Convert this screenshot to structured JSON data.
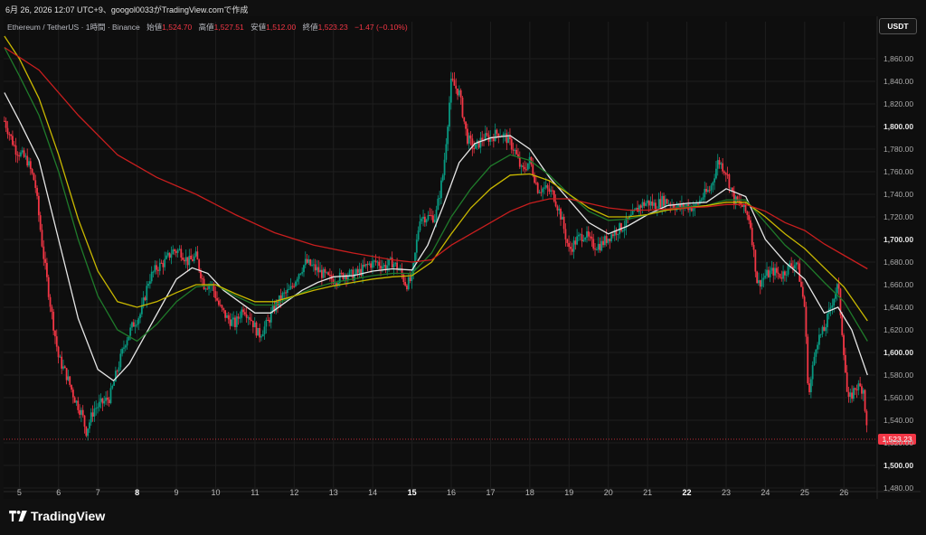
{
  "header": {
    "caption": "6月 26, 2026 12:07 UTC+9、googol0033がTradingView.comで作成"
  },
  "legend": {
    "symbol": "Ethereum / TetherUS · 1時間 · Binance",
    "open_label": "始値",
    "open_value": "1,524.70",
    "high_label": "高値",
    "high_value": "1,527.51",
    "low_label": "安値",
    "low_value": "1,512.00",
    "close_label": "終値",
    "close_value": "1,523.23",
    "change": "−1.47 (−0.10%)"
  },
  "currency_button": "USDT",
  "brand": "TradingView",
  "colors": {
    "up": "#089981",
    "down": "#f23645",
    "ma_fast": "#e6e6e6",
    "ma_mid": "#1f7a2a",
    "ma_slow": "#c9b800",
    "ma_long": "#c81e1e",
    "grid": "#1e1e1e",
    "price_tag": "#f23645"
  },
  "chart_data": {
    "type": "candlestick",
    "title": "Ethereum / TetherUS · 1時間 · Binance",
    "xlabel": "",
    "ylabel": "",
    "ylim": [
      1480,
      1880
    ],
    "y_ticks": [
      1480,
      1500,
      1520,
      1540,
      1560,
      1580,
      1600,
      1620,
      1640,
      1660,
      1680,
      1700,
      1720,
      1740,
      1760,
      1780,
      1800,
      1820,
      1840,
      1860
    ],
    "y_tick_labels": [
      "1,480.00",
      "1,500.00",
      "1,520.00",
      "1,540.00",
      "1,560.00",
      "1,580.00",
      "1,600.00",
      "1,620.00",
      "1,640.00",
      "1,660.00",
      "1,680.00",
      "1,700.00",
      "1,720.00",
      "1,740.00",
      "1,760.00",
      "1,780.00",
      "1,800.00",
      "1,820.00",
      "1,840.00",
      "1,860.00"
    ],
    "bold_y_ticks": [
      "1,500.00",
      "1,600.00",
      "1,700.00",
      "1,800.00"
    ],
    "xlim": [
      4.6,
      26.8
    ],
    "x_ticks": [
      5,
      6,
      7,
      8,
      9,
      10,
      11,
      12,
      13,
      14,
      15,
      16,
      17,
      18,
      19,
      20,
      21,
      22,
      23,
      24,
      25,
      26
    ],
    "x_tick_labels": [
      "5",
      "6",
      "7",
      "8",
      "9",
      "10",
      "11",
      "12",
      "13",
      "14",
      "15",
      "16",
      "17",
      "18",
      "19",
      "20",
      "21",
      "22",
      "23",
      "24",
      "25",
      "26"
    ],
    "bold_x_ticks": [
      "8",
      "15",
      "22"
    ],
    "last_price": 1523.23,
    "last_price_label": "1,523.23",
    "price_path": [
      [
        4.62,
        1805
      ],
      [
        4.9,
        1780
      ],
      [
        5.2,
        1770
      ],
      [
        5.4,
        1750
      ],
      [
        5.6,
        1690
      ],
      [
        5.8,
        1640
      ],
      [
        6.0,
        1595
      ],
      [
        6.2,
        1580
      ],
      [
        6.4,
        1560
      ],
      [
        6.6,
        1545
      ],
      [
        6.7,
        1530
      ],
      [
        6.9,
        1550
      ],
      [
        7.1,
        1555
      ],
      [
        7.3,
        1560
      ],
      [
        7.5,
        1585
      ],
      [
        7.7,
        1610
      ],
      [
        7.9,
        1625
      ],
      [
        8.1,
        1635
      ],
      [
        8.3,
        1665
      ],
      [
        8.5,
        1675
      ],
      [
        8.7,
        1680
      ],
      [
        8.9,
        1690
      ],
      [
        9.1,
        1690
      ],
      [
        9.3,
        1680
      ],
      [
        9.5,
        1685
      ],
      [
        9.7,
        1660
      ],
      [
        9.9,
        1660
      ],
      [
        10.1,
        1640
      ],
      [
        10.3,
        1630
      ],
      [
        10.5,
        1625
      ],
      [
        10.7,
        1640
      ],
      [
        10.9,
        1630
      ],
      [
        11.1,
        1615
      ],
      [
        11.3,
        1625
      ],
      [
        11.5,
        1640
      ],
      [
        11.7,
        1650
      ],
      [
        11.9,
        1655
      ],
      [
        12.1,
        1670
      ],
      [
        12.3,
        1680
      ],
      [
        12.5,
        1675
      ],
      [
        12.7,
        1670
      ],
      [
        12.9,
        1665
      ],
      [
        13.1,
        1665
      ],
      [
        13.3,
        1670
      ],
      [
        13.5,
        1668
      ],
      [
        13.7,
        1672
      ],
      [
        13.9,
        1678
      ],
      [
        14.1,
        1680
      ],
      [
        14.3,
        1676
      ],
      [
        14.5,
        1680
      ],
      [
        14.7,
        1672
      ],
      [
        14.85,
        1660
      ],
      [
        15.0,
        1665
      ],
      [
        15.2,
        1720
      ],
      [
        15.4,
        1720
      ],
      [
        15.6,
        1720
      ],
      [
        15.8,
        1760
      ],
      [
        16.0,
        1840
      ],
      [
        16.2,
        1830
      ],
      [
        16.4,
        1790
      ],
      [
        16.6,
        1780
      ],
      [
        16.8,
        1790
      ],
      [
        17.0,
        1790
      ],
      [
        17.2,
        1795
      ],
      [
        17.4,
        1790
      ],
      [
        17.6,
        1780
      ],
      [
        17.8,
        1760
      ],
      [
        18.0,
        1770
      ],
      [
        18.2,
        1745
      ],
      [
        18.4,
        1745
      ],
      [
        18.6,
        1740
      ],
      [
        18.8,
        1720
      ],
      [
        19.0,
        1690
      ],
      [
        19.2,
        1700
      ],
      [
        19.4,
        1705
      ],
      [
        19.6,
        1695
      ],
      [
        19.8,
        1695
      ],
      [
        20.0,
        1702
      ],
      [
        20.2,
        1708
      ],
      [
        20.4,
        1712
      ],
      [
        20.6,
        1720
      ],
      [
        20.8,
        1730
      ],
      [
        21.0,
        1733
      ],
      [
        21.2,
        1730
      ],
      [
        21.4,
        1735
      ],
      [
        21.6,
        1732
      ],
      [
        21.8,
        1728
      ],
      [
        22.0,
        1730
      ],
      [
        22.2,
        1728
      ],
      [
        22.4,
        1738
      ],
      [
        22.6,
        1745
      ],
      [
        22.8,
        1770
      ],
      [
        23.0,
        1760
      ],
      [
        23.2,
        1735
      ],
      [
        23.4,
        1730
      ],
      [
        23.6,
        1718
      ],
      [
        23.8,
        1660
      ],
      [
        24.0,
        1668
      ],
      [
        24.2,
        1672
      ],
      [
        24.4,
        1668
      ],
      [
        24.6,
        1676
      ],
      [
        24.8,
        1680
      ],
      [
        25.0,
        1640
      ],
      [
        25.1,
        1560
      ],
      [
        25.3,
        1610
      ],
      [
        25.5,
        1620
      ],
      [
        25.7,
        1645
      ],
      [
        25.85,
        1660
      ],
      [
        26.0,
        1600
      ],
      [
        26.1,
        1555
      ],
      [
        26.3,
        1570
      ],
      [
        26.5,
        1568
      ],
      [
        26.6,
        1523
      ]
    ],
    "series": [
      {
        "key": "ma_fast",
        "points": [
          [
            4.62,
            1830
          ],
          [
            5.0,
            1805
          ],
          [
            5.5,
            1770
          ],
          [
            6.0,
            1700
          ],
          [
            6.5,
            1630
          ],
          [
            7.0,
            1585
          ],
          [
            7.4,
            1575
          ],
          [
            7.8,
            1590
          ],
          [
            8.2,
            1615
          ],
          [
            8.6,
            1640
          ],
          [
            9.0,
            1665
          ],
          [
            9.4,
            1675
          ],
          [
            9.8,
            1670
          ],
          [
            10.2,
            1655
          ],
          [
            10.6,
            1645
          ],
          [
            11.0,
            1635
          ],
          [
            11.4,
            1635
          ],
          [
            11.8,
            1645
          ],
          [
            12.2,
            1655
          ],
          [
            12.6,
            1662
          ],
          [
            13.0,
            1667
          ],
          [
            13.5,
            1668
          ],
          [
            14.0,
            1672
          ],
          [
            14.5,
            1674
          ],
          [
            15.0,
            1673
          ],
          [
            15.4,
            1695
          ],
          [
            15.8,
            1730
          ],
          [
            16.2,
            1768
          ],
          [
            16.6,
            1785
          ],
          [
            17.0,
            1790
          ],
          [
            17.5,
            1792
          ],
          [
            18.0,
            1780
          ],
          [
            18.5,
            1755
          ],
          [
            19.0,
            1735
          ],
          [
            19.5,
            1715
          ],
          [
            20.0,
            1705
          ],
          [
            20.5,
            1712
          ],
          [
            21.0,
            1722
          ],
          [
            21.5,
            1730
          ],
          [
            22.0,
            1732
          ],
          [
            22.5,
            1733
          ],
          [
            23.0,
            1745
          ],
          [
            23.5,
            1738
          ],
          [
            24.0,
            1700
          ],
          [
            24.5,
            1680
          ],
          [
            25.0,
            1665
          ],
          [
            25.5,
            1635
          ],
          [
            25.85,
            1640
          ],
          [
            26.2,
            1620
          ],
          [
            26.6,
            1580
          ]
        ]
      },
      {
        "key": "ma_mid",
        "points": [
          [
            4.62,
            1870
          ],
          [
            5.0,
            1845
          ],
          [
            5.5,
            1810
          ],
          [
            6.0,
            1760
          ],
          [
            6.5,
            1700
          ],
          [
            7.0,
            1650
          ],
          [
            7.5,
            1620
          ],
          [
            8.0,
            1610
          ],
          [
            8.5,
            1625
          ],
          [
            9.0,
            1645
          ],
          [
            9.5,
            1658
          ],
          [
            10.0,
            1660
          ],
          [
            10.5,
            1650
          ],
          [
            11.0,
            1642
          ],
          [
            11.5,
            1642
          ],
          [
            12.0,
            1650
          ],
          [
            12.5,
            1657
          ],
          [
            13.0,
            1662
          ],
          [
            13.5,
            1665
          ],
          [
            14.0,
            1668
          ],
          [
            14.5,
            1670
          ],
          [
            15.0,
            1670
          ],
          [
            15.5,
            1688
          ],
          [
            16.0,
            1720
          ],
          [
            16.5,
            1745
          ],
          [
            17.0,
            1765
          ],
          [
            17.5,
            1775
          ],
          [
            18.0,
            1770
          ],
          [
            18.5,
            1757
          ],
          [
            19.0,
            1740
          ],
          [
            19.5,
            1725
          ],
          [
            20.0,
            1717
          ],
          [
            20.5,
            1718
          ],
          [
            21.0,
            1722
          ],
          [
            21.5,
            1727
          ],
          [
            22.0,
            1729
          ],
          [
            22.5,
            1730
          ],
          [
            23.0,
            1735
          ],
          [
            23.5,
            1735
          ],
          [
            24.0,
            1715
          ],
          [
            24.5,
            1695
          ],
          [
            25.0,
            1680
          ],
          [
            25.5,
            1662
          ],
          [
            26.0,
            1645
          ],
          [
            26.6,
            1610
          ]
        ]
      },
      {
        "key": "ma_slow",
        "points": [
          [
            4.62,
            1880
          ],
          [
            5.0,
            1860
          ],
          [
            5.5,
            1825
          ],
          [
            6.0,
            1775
          ],
          [
            6.5,
            1718
          ],
          [
            7.0,
            1672
          ],
          [
            7.5,
            1645
          ],
          [
            8.0,
            1640
          ],
          [
            8.5,
            1645
          ],
          [
            9.0,
            1653
          ],
          [
            9.5,
            1660
          ],
          [
            10.0,
            1660
          ],
          [
            10.5,
            1652
          ],
          [
            11.0,
            1645
          ],
          [
            11.5,
            1645
          ],
          [
            12.0,
            1650
          ],
          [
            12.5,
            1655
          ],
          [
            13.0,
            1659
          ],
          [
            13.5,
            1662
          ],
          [
            14.0,
            1665
          ],
          [
            14.5,
            1667
          ],
          [
            15.0,
            1668
          ],
          [
            15.5,
            1680
          ],
          [
            16.0,
            1705
          ],
          [
            16.5,
            1728
          ],
          [
            17.0,
            1745
          ],
          [
            17.5,
            1757
          ],
          [
            18.0,
            1758
          ],
          [
            18.5,
            1752
          ],
          [
            19.0,
            1740
          ],
          [
            19.5,
            1728
          ],
          [
            20.0,
            1720
          ],
          [
            20.5,
            1720
          ],
          [
            21.0,
            1722
          ],
          [
            21.5,
            1726
          ],
          [
            22.0,
            1728
          ],
          [
            22.5,
            1730
          ],
          [
            23.0,
            1733
          ],
          [
            23.5,
            1733
          ],
          [
            24.0,
            1720
          ],
          [
            24.5,
            1705
          ],
          [
            25.0,
            1692
          ],
          [
            25.5,
            1675
          ],
          [
            26.0,
            1658
          ],
          [
            26.6,
            1628
          ]
        ]
      },
      {
        "key": "ma_long",
        "points": [
          [
            4.62,
            1870
          ],
          [
            5.5,
            1850
          ],
          [
            6.5,
            1810
          ],
          [
            7.5,
            1775
          ],
          [
            8.5,
            1755
          ],
          [
            9.5,
            1740
          ],
          [
            10.5,
            1722
          ],
          [
            11.5,
            1706
          ],
          [
            12.5,
            1695
          ],
          [
            13.5,
            1688
          ],
          [
            14.5,
            1682
          ],
          [
            15.0,
            1680
          ],
          [
            15.5,
            1682
          ],
          [
            16.0,
            1695
          ],
          [
            16.5,
            1705
          ],
          [
            17.0,
            1715
          ],
          [
            17.5,
            1725
          ],
          [
            18.0,
            1732
          ],
          [
            18.5,
            1736
          ],
          [
            19.0,
            1736
          ],
          [
            19.5,
            1732
          ],
          [
            20.0,
            1728
          ],
          [
            20.5,
            1726
          ],
          [
            21.0,
            1726
          ],
          [
            21.5,
            1727
          ],
          [
            22.0,
            1728
          ],
          [
            22.5,
            1729
          ],
          [
            23.0,
            1731
          ],
          [
            23.5,
            1731
          ],
          [
            24.0,
            1725
          ],
          [
            24.5,
            1715
          ],
          [
            25.0,
            1708
          ],
          [
            25.5,
            1696
          ],
          [
            26.0,
            1686
          ],
          [
            26.6,
            1674
          ]
        ]
      }
    ]
  }
}
